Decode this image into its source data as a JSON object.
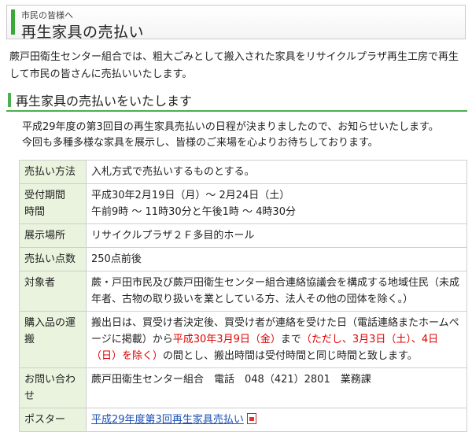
{
  "header": {
    "kicker": "市民の皆様へ",
    "title": "再生家具の売払い"
  },
  "intro": "蕨戸田衛生センター組合では、粗大ごみとして搬入された家具をリサイクルプラザ再生工房で再生して市民の皆さんに売払いいたします。",
  "section_title": "再生家具の売払いをいたします",
  "notice": {
    "line1": "平成29年度の第3回目の再生家具売払いの日程が決まりましたので、お知らせいたします。",
    "line2": "今回も多種多様な家具を展示し、皆様のご来場を心よりお待ちしております。"
  },
  "table": {
    "method": {
      "label": "売払い方法",
      "value": "入札方式で売払いするものとする。"
    },
    "period": {
      "label1": "受付期間",
      "label2": "時間",
      "value1": "平成30年2月19日（月）～ 2月24日（土）",
      "value2": "午前9時 ～ 11時30分と午後1時 ～ 4時30分"
    },
    "venue": {
      "label": "展示場所",
      "value": "リサイクルプラザ２Ｆ多目的ホール"
    },
    "count": {
      "label": "売払い点数",
      "value": "250点前後"
    },
    "eligible": {
      "label": "対象者",
      "value": "蕨・戸田市民及び蕨戸田衛生センター組合連絡協議会を構成する地域住民（未成年者、古物の取り扱いを業としている方、法人その他の団体を除く。）"
    },
    "transport": {
      "label": "購入品の運搬",
      "text1": "搬出日は、買受け者決定後、買受け者が連絡を受けた日（電話連絡またホームページに掲載）から",
      "red1": "平成30年3月9日（金）",
      "text2": "まで",
      "red2": "（ただし、3月3日（土）、4日（日）を除く）",
      "text3": "の間とし、搬出時間は受付時間と同じ時間と致します。"
    },
    "contact": {
      "label": "お問い合わせ",
      "value": "蕨戸田衛生センター組合　電話　048（421）2801　業務課"
    },
    "poster": {
      "label": "ポスター",
      "link": "平成29年度第3回再生家具売払い",
      "icon": "pdf-icon"
    }
  },
  "colors": {
    "accent_green": "#4caf50",
    "label_bg": "#e9f3dd",
    "red": "#e00000",
    "link": "#1a4fb5"
  }
}
